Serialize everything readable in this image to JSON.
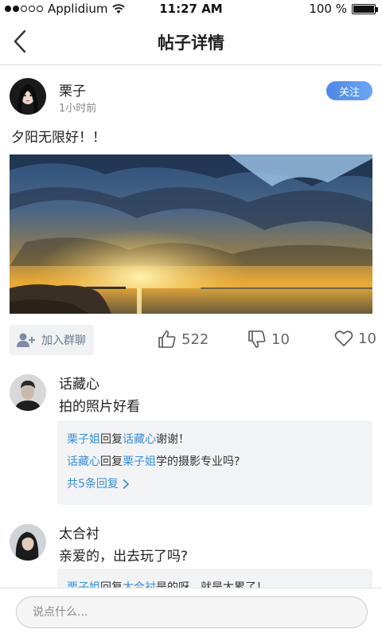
{
  "status_bar": {
    "carrier": "Applidium",
    "time": "11:27 AM",
    "battery": "100 %",
    "battery_level": 1.0,
    "signal_bars": 2
  },
  "nav": {
    "title": "帖子详情",
    "back_icon": "chevron-left-icon"
  },
  "post": {
    "author": "栗子",
    "time": "1小时前",
    "follow_label": "关注",
    "text": "夕阳无限好！！",
    "image": "sunset-over-sea"
  },
  "actions": {
    "join_group_label": "加入群聊",
    "likes": "522",
    "dislikes": "10",
    "favorites": "10"
  },
  "comments": [
    {
      "author": "话藏心",
      "text": "拍的照片好看",
      "replies": [
        {
          "from": "栗子姐",
          "verb": "回复",
          "to": "话藏心",
          "text": "谢谢！"
        },
        {
          "from": "话藏心",
          "verb": "回复",
          "to": "栗子姐",
          "text": "学的摄影专业吗?"
        }
      ],
      "more_label": "共5条回复"
    },
    {
      "author": "太合衬",
      "text": "亲爱的，出去玩了吗?",
      "replies": [
        {
          "from": "栗子姐",
          "verb": "回复",
          "to": "太合衬",
          "text": "是的呀，就是太累了！"
        }
      ]
    }
  ],
  "input": {
    "placeholder": "说点什么..."
  },
  "colors": {
    "accent": "#3a8fd6",
    "follow_button": "#5b93ee"
  }
}
